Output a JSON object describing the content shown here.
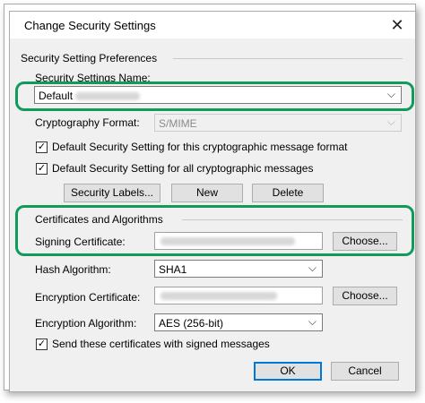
{
  "window": {
    "title": "Change Security Settings",
    "close_glyph": "✕"
  },
  "preferences": {
    "group_title": "Security Setting Preferences",
    "name_label": "Security Settings Name:",
    "name_value": "Default",
    "crypto_label": "Cryptography Format:",
    "crypto_value": "S/MIME",
    "check_format_label": "Default Security Setting for this cryptographic message format",
    "check_all_label": "Default Security Setting for all cryptographic messages",
    "security_labels_button": "Security Labels...",
    "new_button": "New",
    "delete_button": "Delete"
  },
  "certificates": {
    "group_title": "Certificates and Algorithms",
    "signing_label": "Signing Certificate:",
    "choose_label": "Choose...",
    "hash_label": "Hash Algorithm:",
    "hash_value": "SHA1",
    "encryption_cert_label": "Encryption Certificate:",
    "encryption_alg_label": "Encryption Algorithm:",
    "encryption_alg_value": "AES (256-bit)",
    "send_certs_label": "Send these certificates with signed messages"
  },
  "footer": {
    "ok_button": "OK",
    "cancel_button": "Cancel"
  },
  "colors": {
    "highlight": "#119b5b",
    "default_button_border": "#0078d7"
  },
  "checkbox_glyph": "✓",
  "dropdown_glyph": "⌵"
}
